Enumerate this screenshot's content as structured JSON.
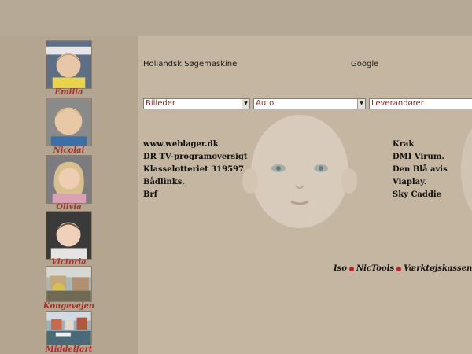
{
  "sidebar": {
    "items": [
      {
        "label": "Emilia"
      },
      {
        "label": "Nicolai"
      },
      {
        "label": "Olivia"
      },
      {
        "label": "Victoria"
      },
      {
        "label": "Kongevejen"
      },
      {
        "label": "Middelfart"
      }
    ],
    "colors": {
      "caption": "#b02a2a",
      "background": "#b3a590"
    }
  },
  "search": {
    "left_label": "Hollandsk Søgemaskine",
    "right_label": "Google",
    "selects": [
      {
        "value": "Billeder"
      },
      {
        "value": "Auto"
      },
      {
        "value": "Leverandører"
      }
    ]
  },
  "links": {
    "left": [
      "www.weblager.dk",
      "DR TV-programoversigt",
      "Klasselotteriet 319597",
      "Bådlinks.",
      "Brf"
    ],
    "right": [
      "Krak",
      "DMI Virum.",
      "Den Blå avis",
      "Viaplay.",
      "Sky Caddie"
    ]
  },
  "footer": {
    "items": [
      "Iso",
      "NicTools",
      "Værktøjskassen."
    ],
    "dot_color": "#c0202a"
  },
  "icons": [
    "baby-face-watermark",
    "photo-thumbnail"
  ]
}
